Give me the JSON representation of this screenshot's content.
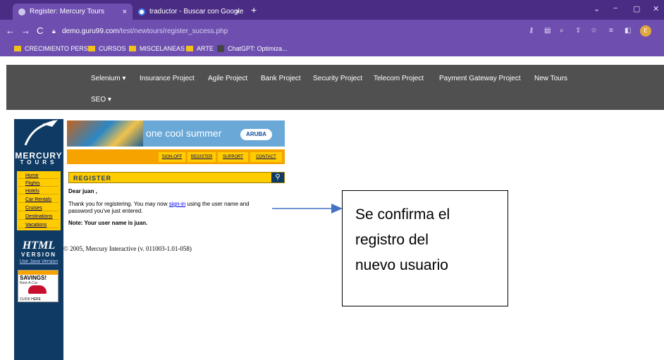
{
  "browser": {
    "tabs": [
      {
        "title": "Register: Mercury Tours",
        "close": "×"
      },
      {
        "title": "traductor - Buscar con Google",
        "close": "×"
      }
    ],
    "new_tab": "+",
    "window_controls": [
      "⌄",
      "−",
      "▢",
      "✕"
    ],
    "address": {
      "domain": "demo.guru99.com",
      "path": "/test/newtours/register_sucess.php"
    },
    "profile_initial": "E",
    "bookmarks": [
      "CRECIMIENTO PERS...",
      "CURSOS",
      "MISCELANEAS",
      "ARTE",
      "ChatGPT: Optimiza..."
    ]
  },
  "site_nav": {
    "items": [
      "Selenium ▾",
      "Insurance Project",
      "Agile Project",
      "Bank Project",
      "Security Project",
      "Telecom Project",
      "Payment Gateway Project",
      "New Tours"
    ],
    "seo": "SEO ▾"
  },
  "mercury": {
    "logo": "MERCURY",
    "logo_sub": "TOURS",
    "banner_text": "one cool summer",
    "banner_brand": "ARUBA",
    "top_menu": [
      "SIGN-OFF",
      "REGISTER",
      "SUPPORT",
      "CONTACT"
    ],
    "left_menu": [
      "Home",
      "Flights",
      "Hotels",
      "Car Rentals",
      "Cruises",
      "Destinations",
      "Vacations"
    ],
    "html_badge": "HTML",
    "version": "VERSION",
    "java_link": "Use Java Version",
    "savings": {
      "title": "SAVINGS!",
      "subtitle": "Rent-A-Car",
      "click": "CLICK HERE"
    },
    "register_title": "REGISTER",
    "greeting": "Dear juan ,",
    "message_1_pre": "Thank you for registering. You may now ",
    "message_1_link": "sign-in",
    "message_1_post": " using the user name and",
    "message_2": "password you've just entered.",
    "note": "Note: Your user name is juan.",
    "copyright": "© 2005, Mercury Interactive (v. 011003-1.01-058)"
  },
  "annotation": {
    "lines": [
      "Se confirma el",
      "registro del",
      "nuevo usuario"
    ]
  }
}
